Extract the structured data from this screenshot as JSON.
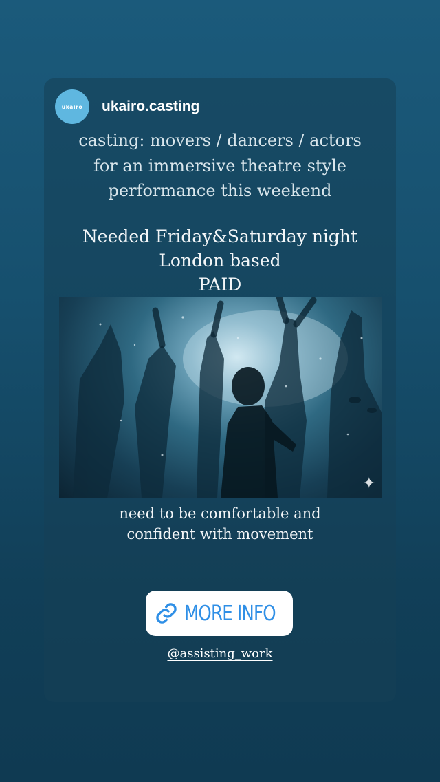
{
  "story": {
    "username": "ukairo.casting",
    "avatar_text": "ukairo",
    "headline_lines": [
      "casting: movers / dancers / actors",
      "for an immersive theatre style",
      "performance this weekend"
    ],
    "detail_lines": [
      "Needed Friday&Saturday night",
      "London based",
      "PAID"
    ],
    "requirement_lines": [
      "need to be comfortable and",
      "confident with movement"
    ],
    "link_button_label": "MORE INFO",
    "mention": "@assisting_work",
    "link_icon": "link-icon",
    "sparkle_icon": "sparkle-icon"
  },
  "colors": {
    "background_top": "#1b5a7b",
    "background_bottom": "#0f3a52",
    "avatar": "#5fb7e0",
    "link_blue": "#2f8fe6"
  }
}
